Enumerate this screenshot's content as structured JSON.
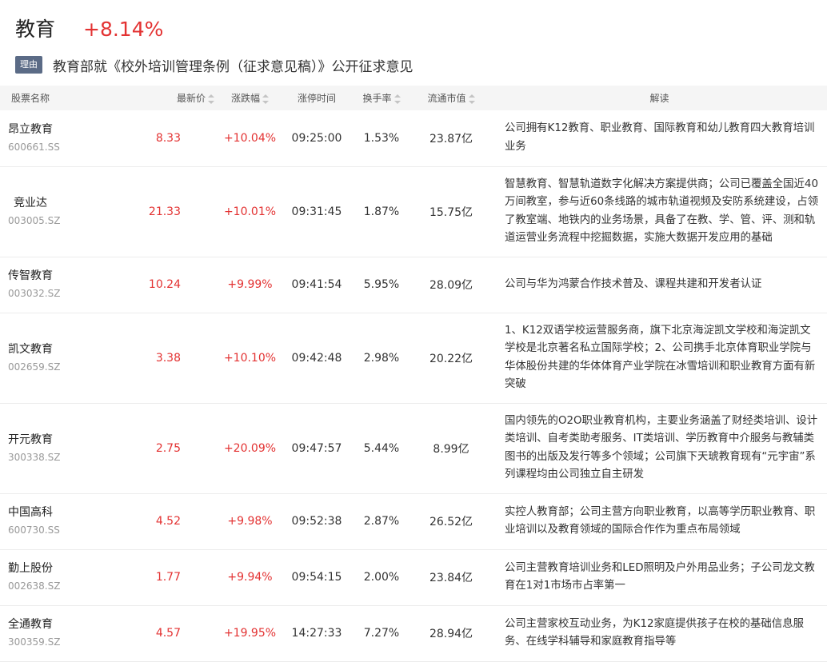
{
  "sector": {
    "name": "教育",
    "change": "+8.14%",
    "reason_badge": "理由",
    "reason_text": "教育部就《校外培训管理条例（征求意见稿）》公开征求意见"
  },
  "table": {
    "headers": {
      "name": "股票名称",
      "price": "最新价",
      "change": "涨跌幅",
      "limit_time": "涨停时间",
      "turnover": "换手率",
      "market_cap": "流通市值",
      "interpretation": "解读"
    },
    "rows": [
      {
        "name": "昂立教育",
        "code": "600661.SS",
        "price": "8.33",
        "change": "+10.04%",
        "time": "09:25:00",
        "turnover": "1.53%",
        "cap": "23.87亿",
        "desc": "公司拥有K12教育、职业教育、国际教育和幼儿教育四大教育培训业务"
      },
      {
        "name": "竞业达",
        "code": "003005.SZ",
        "price": "21.33",
        "change": "+10.01%",
        "time": "09:31:45",
        "turnover": "1.87%",
        "cap": "15.75亿",
        "desc": "智慧教育、智慧轨道数字化解决方案提供商；公司已覆盖全国近40万间教室，参与近60条线路的城市轨道视频及安防系统建设，占领了教室端、地铁内的业务场景，具备了在教、学、管、评、测和轨道运营业务流程中挖掘数据，实施大数据开发应用的基础"
      },
      {
        "name": "传智教育",
        "code": "003032.SZ",
        "price": "10.24",
        "change": "+9.99%",
        "time": "09:41:54",
        "turnover": "5.95%",
        "cap": "28.09亿",
        "desc": "公司与华为鸿蒙合作技术普及、课程共建和开发者认证"
      },
      {
        "name": "凯文教育",
        "code": "002659.SZ",
        "price": "3.38",
        "change": "+10.10%",
        "time": "09:42:48",
        "turnover": "2.98%",
        "cap": "20.22亿",
        "desc": "1、K12双语学校运营服务商，旗下北京海淀凯文学校和海淀凯文学校是北京著名私立国际学校；2、公司携手北京体育职业学院与华体股份共建的华体体育产业学院在冰雪培训和职业教育方面有新突破"
      },
      {
        "name": "开元教育",
        "code": "300338.SZ",
        "price": "2.75",
        "change": "+20.09%",
        "time": "09:47:57",
        "turnover": "5.44%",
        "cap": "8.99亿",
        "desc": "国内领先的O2O职业教育机构，主要业务涵盖了财经类培训、设计类培训、自考类助考服务、IT类培训、学历教育中介服务与教辅类图书的出版及发行等多个领域；公司旗下天琥教育现有“元宇宙”系列课程均由公司独立自主研发"
      },
      {
        "name": "中国高科",
        "code": "600730.SS",
        "price": "4.52",
        "change": "+9.98%",
        "time": "09:52:38",
        "turnover": "2.87%",
        "cap": "26.52亿",
        "desc": "实控人教育部；公司主营方向职业教育，以高等学历职业教育、职业培训以及教育领域的国际合作作为重点布局领域"
      },
      {
        "name": "勤上股份",
        "code": "002638.SZ",
        "price": "1.77",
        "change": "+9.94%",
        "time": "09:54:15",
        "turnover": "2.00%",
        "cap": "23.84亿",
        "desc": "公司主营教育培训业务和LED照明及户外用品业务；子公司龙文教育在1对1市场市占率第一"
      },
      {
        "name": "全通教育",
        "code": "300359.SZ",
        "price": "4.57",
        "change": "+19.95%",
        "time": "14:27:33",
        "turnover": "7.27%",
        "cap": "28.94亿",
        "desc": "公司主营家校互动业务，为K12家庭提供孩子在校的基础信息服务、在线学科辅导和家庭教育指导等"
      }
    ]
  },
  "colors": {
    "up": "#e33232",
    "badge": "#5b6b86"
  },
  "icons": {
    "sort": "sort-arrows-icon"
  }
}
